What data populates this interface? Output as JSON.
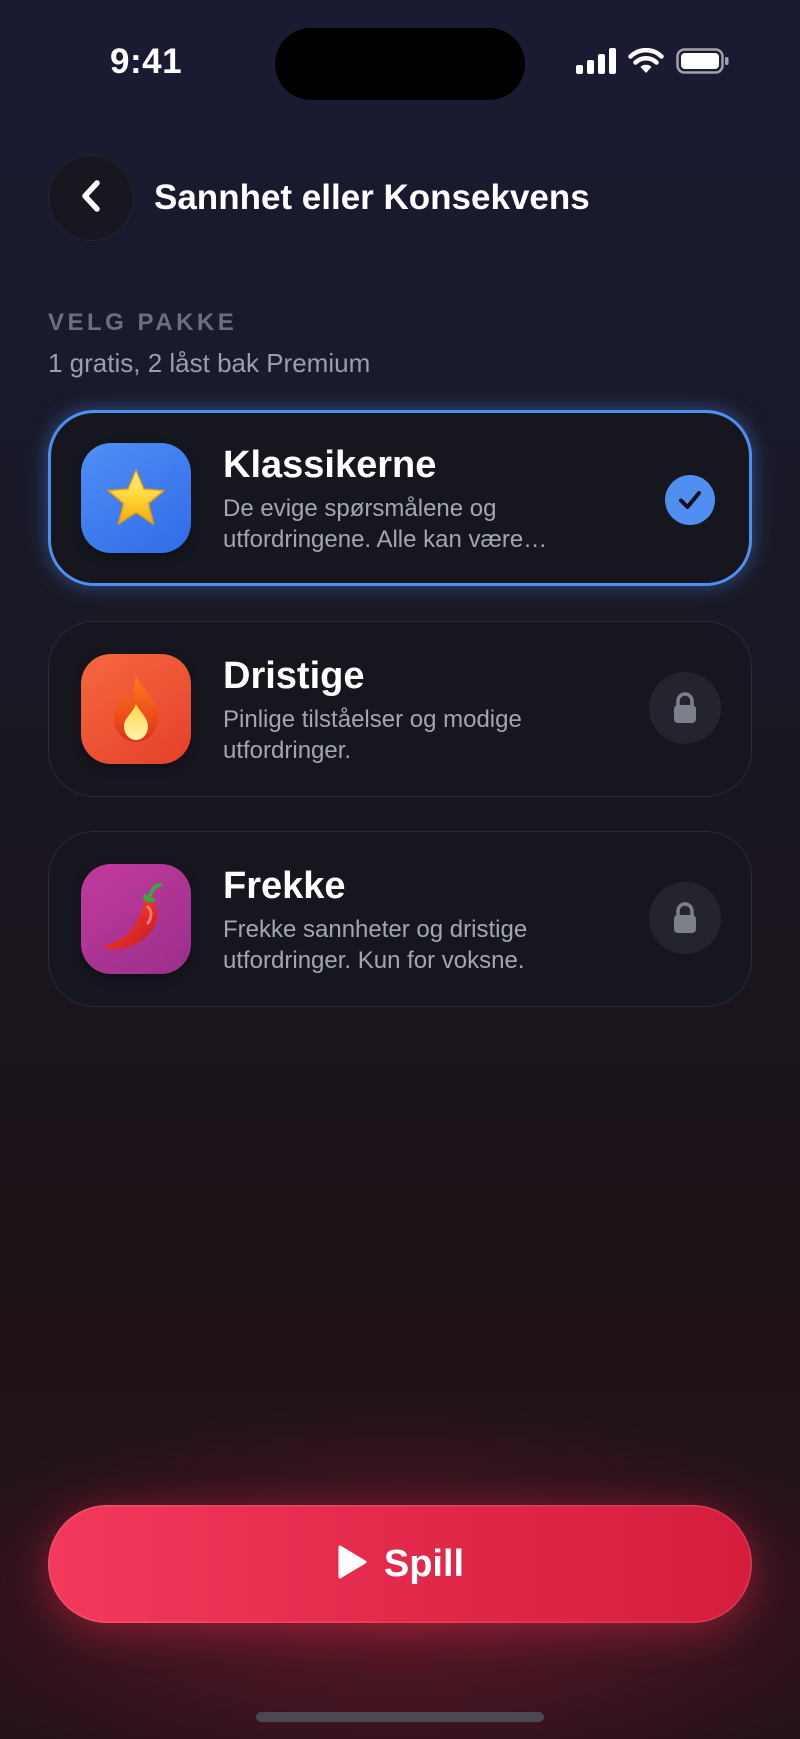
{
  "status_bar": {
    "time": "9:41"
  },
  "header": {
    "title": "Sannhet eller Konsekvens"
  },
  "section": {
    "label": "VELG PAKKE",
    "subtitle": "1 gratis, 2 låst bak Premium"
  },
  "packs": [
    {
      "name": "Klassikerne",
      "description_line1": "De evige spørsmålene og",
      "description_line2": "utfordringene. Alle kan være…",
      "icon": "star-icon",
      "emoji": "⭐",
      "state": "selected"
    },
    {
      "name": "Dristige",
      "description_line1": "Pinlige tilståelser og modige",
      "description_line2": "utfordringer.",
      "icon": "fire-icon",
      "emoji": "🔥",
      "state": "locked"
    },
    {
      "name": "Frekke",
      "description_line1": "Frekke sannheter og dristige",
      "description_line2": "utfordringer. Kun for voksne.",
      "icon": "chili-pepper-icon",
      "emoji": "🌶️",
      "state": "locked"
    }
  ],
  "play_button": {
    "label": "Spill"
  },
  "colors": {
    "accent_blue": "#4f8ff2",
    "accent_red": "#e22849",
    "icon_blue": "#3b7cf0",
    "icon_orange": "#f0543a",
    "icon_magenta": "#b0338f"
  }
}
